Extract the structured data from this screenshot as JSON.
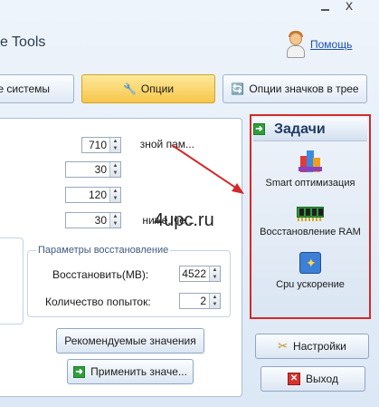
{
  "window": {
    "title": "e Tools"
  },
  "header": {
    "help_label": "Помощь"
  },
  "tabs": [
    {
      "label": "е системы"
    },
    {
      "label": "Опции"
    },
    {
      "label": "Опции значков в трее"
    }
  ],
  "options": [
    {
      "label": "зной пам...",
      "value": "710"
    },
    {
      "label": "",
      "value": "30"
    },
    {
      "label": "",
      "value": "120"
    },
    {
      "label": "ниже, че...",
      "value": "30"
    }
  ],
  "restore": {
    "legend": "Параметры восстановление",
    "restore_label": "Восстановить(MB):",
    "restore_value": "4522",
    "attempts_label": "Количество попыток:",
    "attempts_value": "2"
  },
  "buttons": {
    "recommend": "Рекомендуемые значения",
    "apply": "Применить значе...",
    "settings": "Настройки",
    "exit": "Выход"
  },
  "tasks": {
    "title": "Задачи",
    "items": [
      {
        "label": "Smart оптимизация",
        "icon": "smart-optimize-icon"
      },
      {
        "label": "Восстановление RAM",
        "icon": "ram-module-icon"
      },
      {
        "label": "Cpu ускорение",
        "icon": "cpu-boost-icon"
      }
    ]
  },
  "watermark": "4upc.ru",
  "colors": {
    "highlight_border": "#d22a2a",
    "active_tab": "#f7c64a",
    "accent_text": "#1f3c66"
  }
}
